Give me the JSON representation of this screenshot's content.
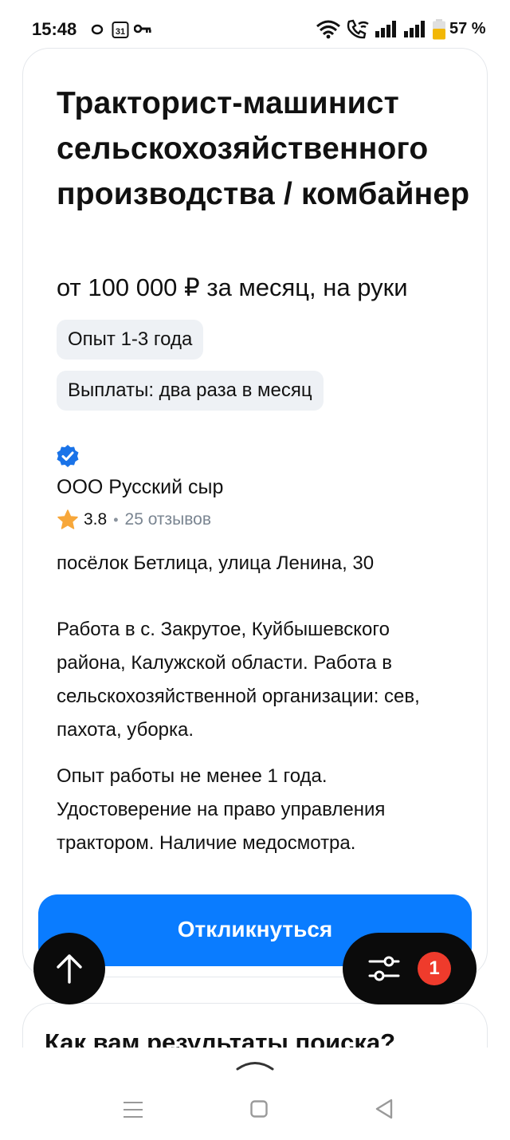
{
  "status_bar": {
    "time": "15:48",
    "calendar_day": "31",
    "battery_percent": "57 %",
    "icons": [
      "circle-notification-icon",
      "calendar-icon",
      "key-icon",
      "wifi-icon",
      "wifi-call-icon",
      "signal-icon",
      "signal-icon",
      "battery-icon"
    ]
  },
  "vacancy": {
    "title": "Тракторист-машинист сельскохозяйственного производства / комбайнер",
    "salary": "от 100 000 ₽ за месяц, на руки",
    "tags": [
      "Опыт 1-3 года",
      "Выплаты: два раза в месяц"
    ],
    "company": {
      "name": "ООО Русский сыр",
      "verified_icon": "verified-badge-icon",
      "rating": "3.8",
      "separator": "•",
      "reviews": "25 отзывов"
    },
    "address": "посёлок Бетлица, улица Ленина, 30",
    "description": [
      "Работа в с. Закрутое, Куйбышевского района, Калужской области. Работа в сельскохозяйственной организации: сев, пахота, уборка.",
      "Опыт работы не менее 1 года. Удостоверение на право управления трактором. Наличие медосмотра."
    ],
    "apply_label": "Откликнуться"
  },
  "floating": {
    "scroll_top_icon": "arrow-up-icon",
    "filter_icon": "sliders-icon",
    "filter_count": "1"
  },
  "feedback": {
    "title": "Как вам результаты поиска?"
  },
  "colors": {
    "accent": "#0a7cff",
    "badge": "#ef3b2c",
    "chip_bg": "#eef1f5",
    "star": "#f7a73a",
    "verified": "#1a73e8"
  }
}
